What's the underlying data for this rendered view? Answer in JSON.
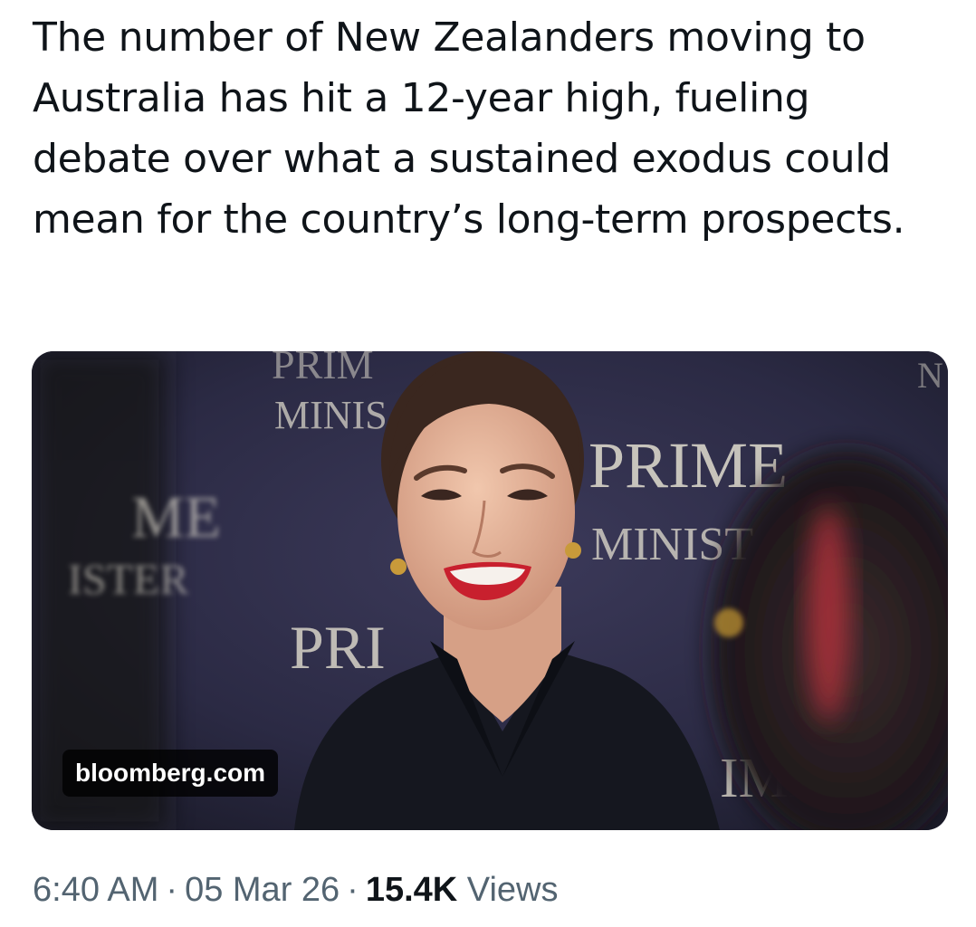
{
  "tweet": {
    "text": "The number of New Zealanders moving to Australia has hit a 12-year high, fueling debate over what a sustained exodus could mean for the country’s long-term prospects."
  },
  "card": {
    "domain": "bloomberg.com",
    "backdrop_words": {
      "top_left_partial": "PRIM",
      "top_left_sub": "MINIS",
      "left_big": "ME",
      "left_sub": "ISTER",
      "right_big": "PRIME",
      "right_sub": "MINIST",
      "center_low": "PRI",
      "bottom_right": "IME",
      "top_right_edge": "N"
    }
  },
  "meta": {
    "time": "6:40 AM",
    "separator": "·",
    "date": "05 Mar 26",
    "views_count": "15.4K",
    "views_label": "Views"
  },
  "colors": {
    "backdrop": "#2e2c48",
    "backdrop_text": "#d8d4c8",
    "skin": "#e8b69c",
    "hair": "#3a271f",
    "jacket": "#15171f",
    "lips": "#c8202e",
    "meta_grey": "#536471"
  }
}
